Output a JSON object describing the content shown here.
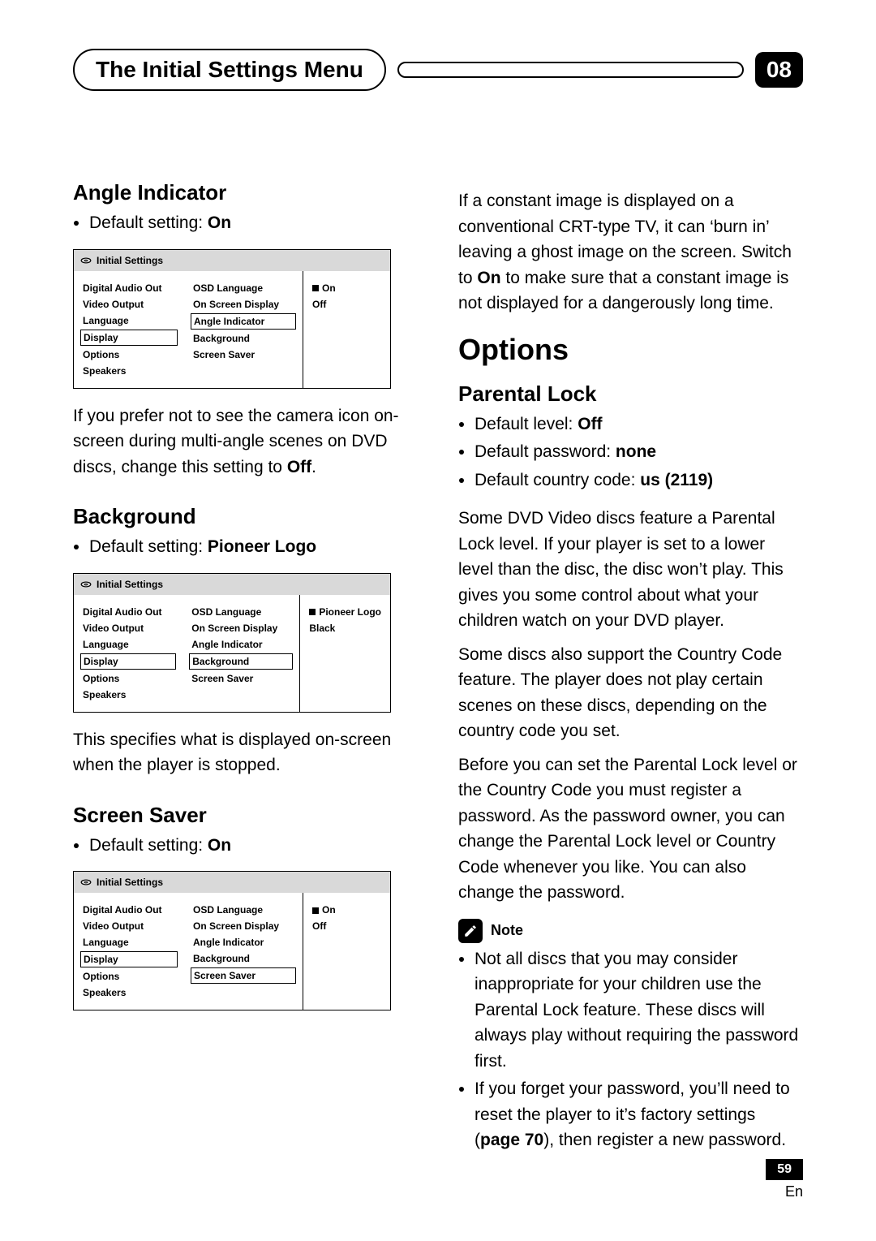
{
  "header": {
    "title": "The Initial Settings Menu",
    "chapter": "08"
  },
  "shot_common": {
    "bar_title": "Initial Settings",
    "col1": [
      "Digital Audio Out",
      "Video Output",
      "Language",
      "Display",
      "Options",
      "Speakers"
    ],
    "col2": [
      "OSD Language",
      "On Screen Display",
      "Angle Indicator",
      "Background",
      "Screen Saver"
    ]
  },
  "angle": {
    "heading": "Angle Indicator",
    "bullet_prefix": "Default setting: ",
    "bullet_value": "On",
    "col1_selected": 3,
    "col2_selected": 2,
    "col3": [
      "On",
      "Off"
    ],
    "col3_marked": 0,
    "para_a": "If you prefer not to see the camera icon on-screen during multi-angle scenes on DVD discs, change this setting to ",
    "para_b": "Off",
    "para_c": "."
  },
  "background": {
    "heading": "Background",
    "bullet_prefix": "Default setting: ",
    "bullet_value": "Pioneer Logo",
    "col1_selected": 3,
    "col2_selected": 3,
    "col3": [
      "Pioneer Logo",
      "Black"
    ],
    "col3_marked": 0,
    "para": "This specifies what is displayed on-screen when the player is stopped."
  },
  "screensaver": {
    "heading": "Screen Saver",
    "bullet_prefix": "Default setting: ",
    "bullet_value": "On",
    "col1_selected": 3,
    "col2_selected": 4,
    "col3": [
      "On",
      "Off"
    ],
    "col3_marked": 0
  },
  "rcol": {
    "crt_a": "If a constant image is displayed on a conventional CRT-type TV, it can ‘burn in’ leaving a ghost image on the screen. Switch to ",
    "crt_b": "On",
    "crt_c": " to make sure that a constant image is not displayed for a dangerously long time.",
    "options_heading": "Options",
    "parental_heading": "Parental Lock",
    "pl1_a": "Default level: ",
    "pl1_b": "Off",
    "pl2_a": "Default password: ",
    "pl2_b": "none",
    "pl3_a": "Default country code: ",
    "pl3_b": "us (2119)",
    "p1": "Some DVD Video discs feature a Parental Lock level. If your player is set to a lower level than the disc, the disc won’t play. This gives you some control about what your children watch on your DVD player.",
    "p2": "Some discs also support the Country Code feature. The player does not play certain scenes on these discs, depending on the country code you set.",
    "p3": "Before you can set the Parental Lock level or the Country Code you must register a password. As the password owner, you can change the Parental Lock level or Country Code whenever you like. You can also change the password.",
    "note_label": "Note",
    "note1": "Not all discs that you may consider inappropriate for your children use the Parental Lock feature. These discs will always play without requiring the password first.",
    "note2_a": "If you forget your password, you’ll need to reset the player to it’s factory settings (",
    "note2_b": "page 70",
    "note2_c": "), then register a new password."
  },
  "footer": {
    "page": "59",
    "lang": "En"
  }
}
